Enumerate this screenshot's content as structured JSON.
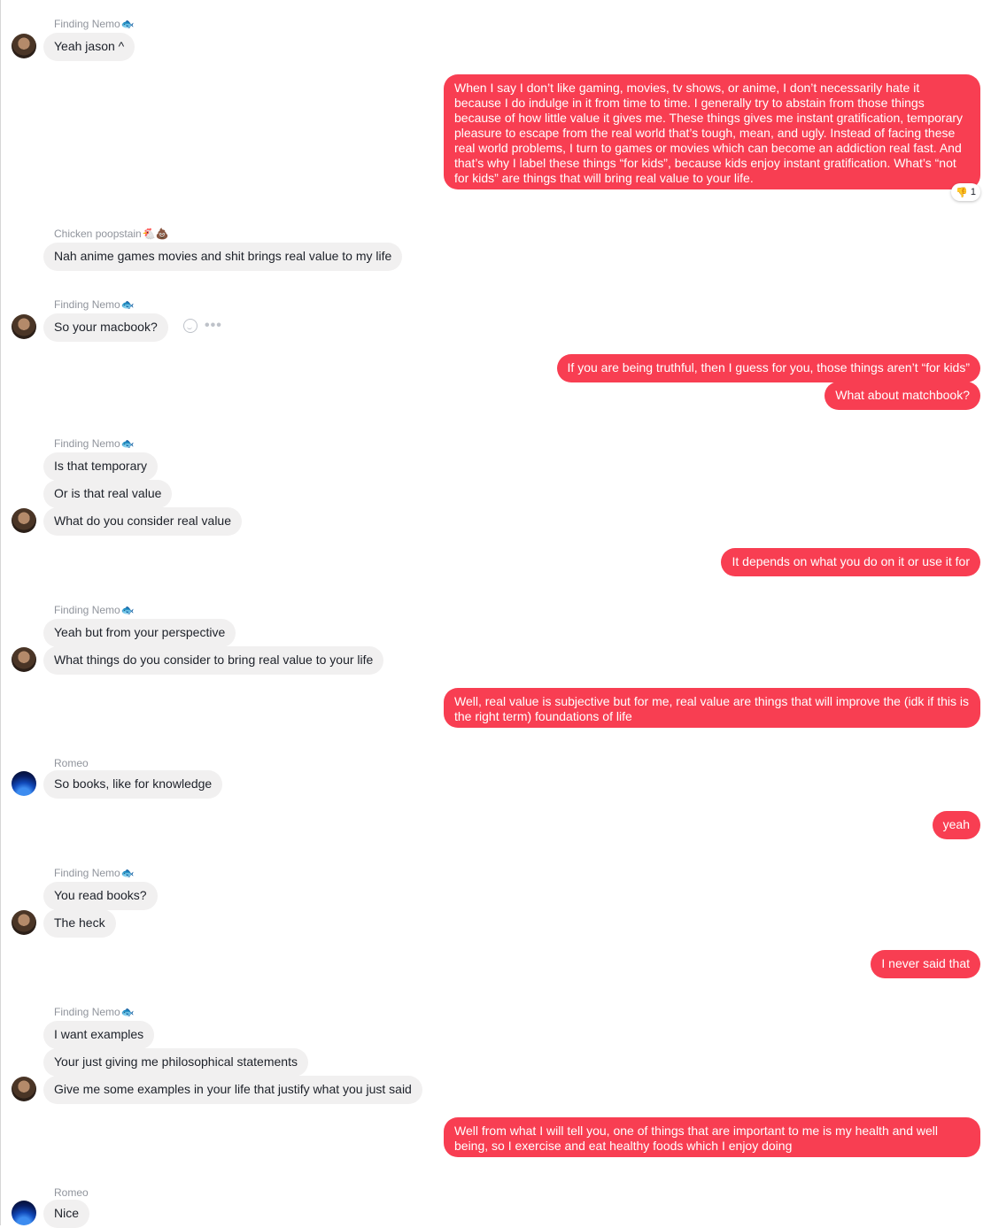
{
  "reaction": {
    "emoji": "👎",
    "count": "1"
  },
  "names": {
    "n1": "Finding Nemo",
    "n1e": "🐟",
    "n2": "Chicken poopstain",
    "n2e": "🐔💩",
    "n3": "Finding Nemo",
    "n3e": "🐟",
    "n4": "Finding Nemo",
    "n4e": "🐟",
    "n5": "Finding Nemo",
    "n5e": "🐟",
    "n6": "Romeo",
    "n7": "Finding Nemo",
    "n7e": "🐟",
    "n8": "Finding Nemo",
    "n8e": "🐟",
    "n9": "Romeo"
  },
  "messages": {
    "m1": "Yeah jason ^",
    "m2": "When I say I don’t like gaming, movies, tv shows, or anime, I don’t necessarily hate it because I do  indulge in it from time to time. I generally try to abstain from those things because of how little value it gives me. These things gives me instant gratification, temporary pleasure to escape from the real world that’s tough, mean, and ugly. Instead of facing these real world problems, I turn to games or movies which can become an addiction real fast. And that’s why I label these things “for kids”, because kids enjoy instant gratification. What’s “not for kids” are things that will bring real value to your life.",
    "m3": "Nah anime games movies and shit brings real value to my life",
    "m4": "So your macbook?",
    "m5": "If you are being truthful, then I guess for you, those things aren’t “for kids”",
    "m6": "What about matchbook?",
    "m7": "Is that temporary",
    "m8": "Or is that real value",
    "m9": "What do you consider real value",
    "m10": "It depends on what you do on it or use it for",
    "m11": "Yeah but from your perspective",
    "m12": "What things do you consider to bring real value to your life",
    "m13": "Well, real value is subjective but for me, real value are things that will improve the (idk if this is the right term) foundations of life",
    "m14": "So books, like for knowledge",
    "m15": "yeah",
    "m16": "You read books?",
    "m17": "The heck",
    "m18": "I never said that",
    "m19": "I want examples",
    "m20": "Your just giving me philosophical statements",
    "m21": "Give me some examples in your life that justify what you just said",
    "m22": "Well from what I will tell you, one of things that are important to me is my health and well being, so I exercise and eat healthy foods which I enjoy doing",
    "m23": "Nice"
  },
  "colors": {
    "outgoing": "#f83e52",
    "incoming": "#f1f0f0",
    "name": "#90949c"
  }
}
